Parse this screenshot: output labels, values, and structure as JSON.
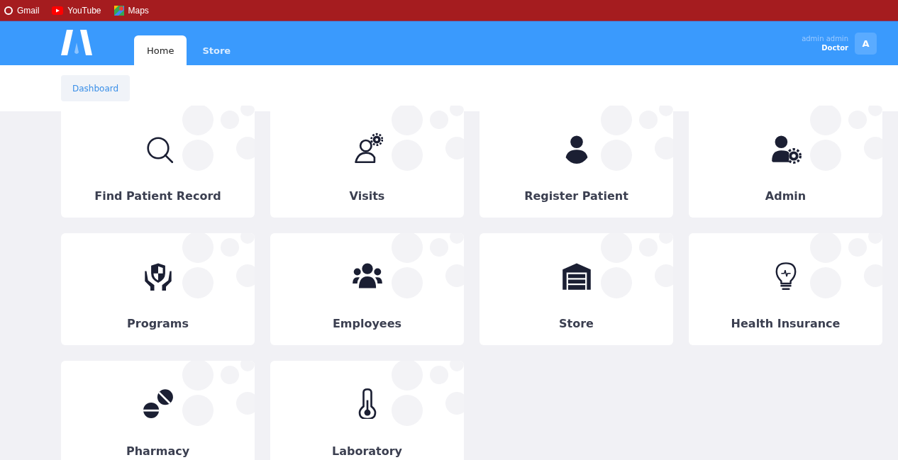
{
  "bookmarks": [
    {
      "label": "Gmail"
    },
    {
      "label": "YouTube"
    },
    {
      "label": "Maps"
    }
  ],
  "tabs": [
    {
      "label": "Home",
      "selected": true
    },
    {
      "label": "Store",
      "selected": false
    }
  ],
  "user": {
    "name": "admin admin",
    "role": "Doctor",
    "avatar": "A"
  },
  "breadcrumb": "Dashboard",
  "modules": [
    {
      "label": "Find Patient Record"
    },
    {
      "label": "Visits"
    },
    {
      "label": "Register Patient"
    },
    {
      "label": "Admin"
    },
    {
      "label": "Programs"
    },
    {
      "label": "Employees"
    },
    {
      "label": "Store"
    },
    {
      "label": "Health Insurance"
    },
    {
      "label": "Pharmacy"
    },
    {
      "label": "Laboratory"
    }
  ]
}
